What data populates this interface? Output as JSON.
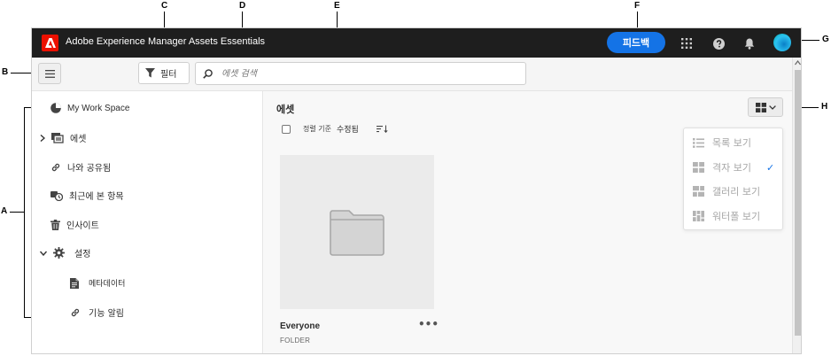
{
  "callouts": [
    "A",
    "B",
    "C",
    "D",
    "E",
    "F",
    "G",
    "H"
  ],
  "topbar": {
    "app_title": "Adobe Experience Manager Assets Essentials",
    "feedback_label": "피드백"
  },
  "toolbar": {
    "filter_label": "필터",
    "search_placeholder": "에셋 검색"
  },
  "sidebar": {
    "items": [
      {
        "label": "My Work Space",
        "icon": "workspace-icon"
      },
      {
        "label": "에셋",
        "icon": "assets-icon"
      },
      {
        "label": "나와 공유됨",
        "icon": "link-icon"
      },
      {
        "label": "최근에 본 항목",
        "icon": "recent-icon"
      },
      {
        "label": "인사이트",
        "icon": "trash-icon"
      },
      {
        "label": "설정",
        "icon": "gear-icon"
      },
      {
        "label": "메타데이터",
        "icon": "document-icon"
      },
      {
        "label": "기능 알림",
        "icon": "link-icon"
      }
    ]
  },
  "main": {
    "title": "에셋",
    "sort_prefix": "정렬 기준",
    "sort_value": "수정됨"
  },
  "card": {
    "name": "Everyone",
    "type": "FOLDER",
    "more": "•••"
  },
  "view_menu": {
    "items": [
      "목록 보기",
      "격자 보기",
      "갤러리 보기",
      "워터폴 보기"
    ],
    "selected": "격자 보기",
    "check": "✓"
  },
  "colors": {
    "topbar": "#1e1e1e",
    "accent": "#1473e6",
    "adobe_red": "#eb1000"
  }
}
